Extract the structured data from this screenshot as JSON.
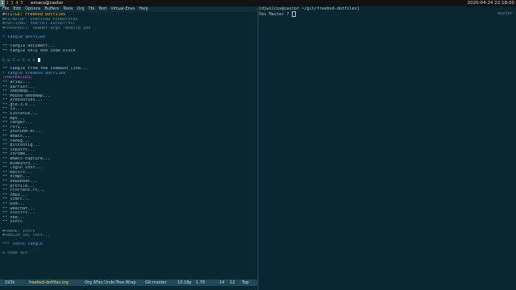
{
  "window": {
    "tags": [
      "1",
      "2",
      "3",
      "4",
      "5"
    ],
    "active_tag": "1",
    "title": "emacs@castor",
    "datetime": "2020-04-24 22:18:00"
  },
  "emacs": {
    "menu": [
      "File",
      "Edit",
      "Options",
      "Buffers",
      "Tools",
      "Org",
      "Tbl",
      "Text",
      "Virtual-Envs",
      "Help"
    ],
    "lines": [
      {
        "t": "#+TITLE: Freebsd Dotfiles",
        "c": "title"
      },
      {
        "t": "#+STARTUP: overview hideblocks",
        "c": "meta"
      },
      {
        "t": "#+OPTIONS: num:nil author:nil",
        "c": "meta"
      },
      {
        "t": "#+PROPERTY: header-args :mkdirp yes",
        "c": "meta"
      },
      {
        "t": "",
        "c": "h2"
      },
      {
        "t": "* tangle dotfiles",
        "c": "h1"
      },
      {
        "t": "",
        "c": "h2"
      },
      {
        "t": "** tangle document...",
        "c": "h2"
      },
      {
        "t": "** tangle only one code block",
        "c": "h2"
      },
      {
        "t": "",
        "c": "h2"
      },
      {
        "t": "C-u C-c C-v t",
        "c": "kbd",
        "cursor": true
      },
      {
        "t": "",
        "c": "h2"
      },
      {
        "t": "** tangle from the command line...",
        "c": "h2"
      },
      {
        "t": "* tangle freebsd dotfiles",
        "c": "h1"
      },
      {
        "t": ":PROPERTIES:",
        "c": "prop"
      },
      {
        "t": "** aria2...",
        "c": "h2"
      },
      {
        "t": "** barrier...",
        "c": "h2"
      },
      {
        "t": "** Xmodmap...",
        "c": "h2"
      },
      {
        "t": "** Mouse-Xmodmap...",
        "c": "h2"
      },
      {
        "t": "** Xresources...",
        "c": "h2"
      },
      {
        "t": "** gtk-3.0...",
        "c": "h2"
      },
      {
        "t": "** i3...",
        "c": "h2"
      },
      {
        "t": "** i3status...",
        "c": "h2"
      },
      {
        "t": "** mpv...",
        "c": "h2"
      },
      {
        "t": "** ranger...",
        "c": "h2"
      },
      {
        "t": "** rofi...",
        "c": "h2"
      },
      {
        "t": "** youtube-dl...",
        "c": "h2"
      },
      {
        "t": "** emacs...",
        "c": "h2"
      },
      {
        "t": "** fehbg...",
        "c": "h2"
      },
      {
        "t": "** gitconfig...",
        "c": "h2"
      },
      {
        "t": "** inputrc...",
        "c": "h2"
      },
      {
        "t": "** chrome...",
        "c": "h2"
      },
      {
        "t": "** emacs-capture...",
        "c": "h2"
      },
      {
        "t": "** mimeinfo...",
        "c": "h2"
      },
      {
        "t": "** login_conf...",
        "c": "h2"
      },
      {
        "t": "** muttrc...",
        "c": "h2"
      },
      {
        "t": "** ncmpc...",
        "c": "h2"
      },
      {
        "t": "** newsboat...",
        "c": "h2"
      },
      {
        "t": "** profile...",
        "c": "h2"
      },
      {
        "t": "** rtorrent.rc...",
        "c": "h2"
      },
      {
        "t": "** tmux...",
        "c": "h2"
      },
      {
        "t": "** vimrc...",
        "c": "h2"
      },
      {
        "t": "** w3m...",
        "c": "h2"
      },
      {
        "t": "** weechat...",
        "c": "h2"
      },
      {
        "t": "** xinitrc...",
        "c": "h2"
      },
      {
        "t": "** xkb...",
        "c": "h2"
      },
      {
        "t": "** zshrc",
        "c": "h2"
      },
      {
        "t": "",
        "c": "h2"
      },
      {
        "t": "#+NAME: zshrc",
        "c": "meta"
      },
      {
        "t": "#+BEGIN_SRC conf...",
        "c": "meta"
      },
      {
        "t": "",
        "c": "h2"
      },
      {
        "t": "*** zshrc tangle",
        "c": "h1"
      },
      {
        "t": "",
        "c": "h2"
      },
      {
        "t": "+ home dir",
        "c": "meta"
      }
    ],
    "modeline": {
      "size": "193k",
      "buffer": "freebsd-dotfiles.org",
      "modes": "Org AFav Undo-Tree Wrap",
      "vc": "Git:master",
      "time": "10:18p",
      "load": "1.78",
      "line": "14",
      "col": "12",
      "position": "Top"
    }
  },
  "terminal": {
    "prompt": "[djwilcox@castor ~/git/freebsd-dotfiles]",
    "line2": "Yes Master ? ",
    "side_label": "master"
  }
}
